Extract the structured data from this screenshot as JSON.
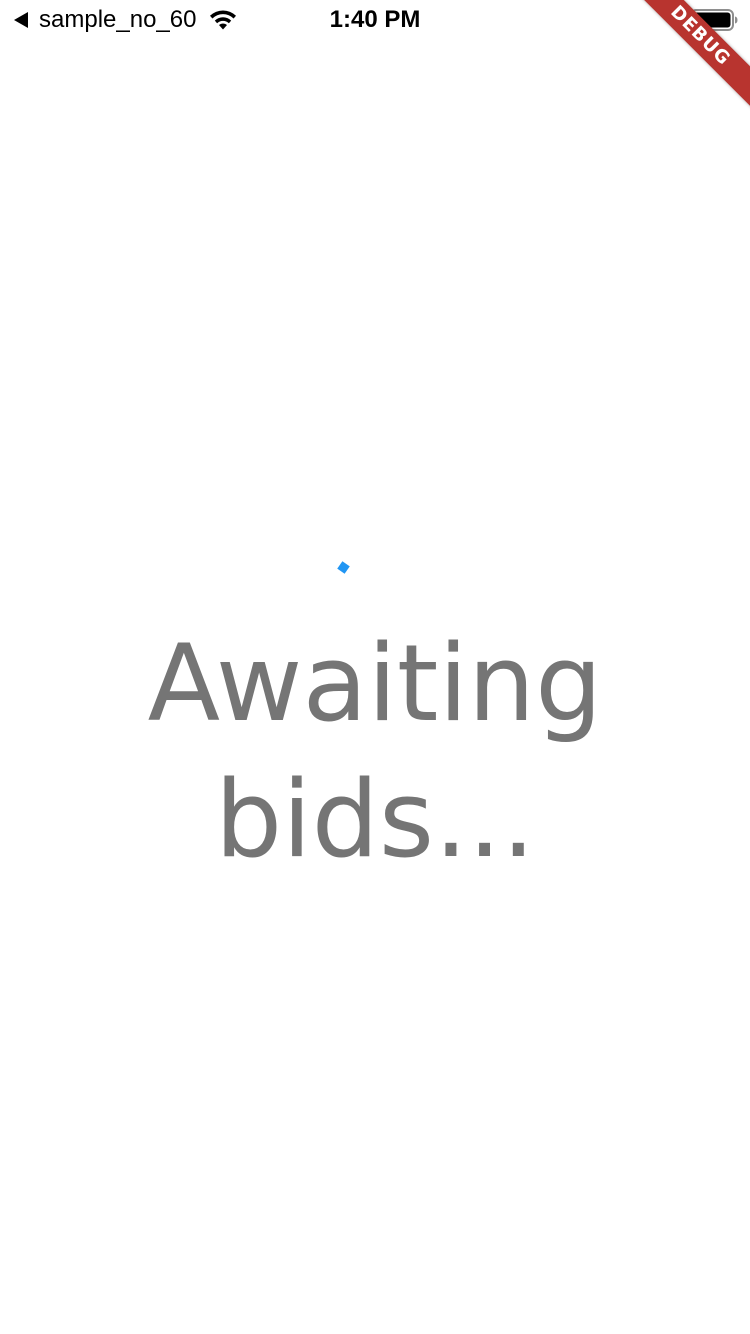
{
  "status_bar": {
    "back_icon": "back-arrow-icon",
    "app_name": "sample_no_60",
    "wifi_icon": "wifi-icon",
    "time": "1:40 PM",
    "battery_icon": "battery-icon"
  },
  "debug_banner": {
    "label": "DEBUG",
    "color": "#b8342f"
  },
  "content": {
    "spinner_icon": "loading-spinner-icon",
    "spinner_color": "#2196f3",
    "message": "Awaiting bids...",
    "message_color": "#757575"
  }
}
